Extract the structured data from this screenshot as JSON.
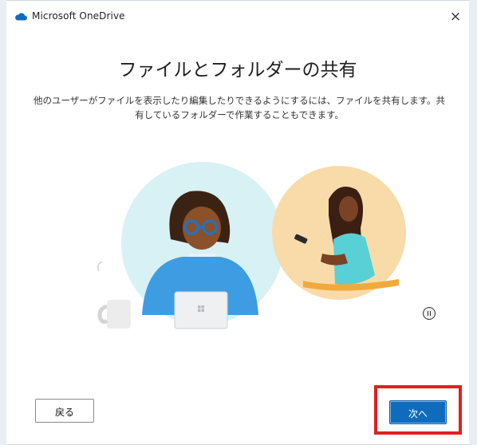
{
  "window": {
    "title": "Microsoft OneDrive",
    "close_label": "×"
  },
  "content": {
    "heading": "ファイルとフォルダーの共有",
    "description": "他のユーザーがファイルを表示したり編集したりできるようにするには、ファイルを共有します。共有しているフォルダーで作業することもできます。"
  },
  "buttons": {
    "back_label": "戻る",
    "next_label": "次へ"
  },
  "colors": {
    "accent": "#0f6cbd",
    "highlight": "#e02020",
    "cloud": "#0f6cbd"
  },
  "icons": {
    "app": "cloud-icon",
    "close": "close-icon",
    "pause": "pause-icon"
  }
}
